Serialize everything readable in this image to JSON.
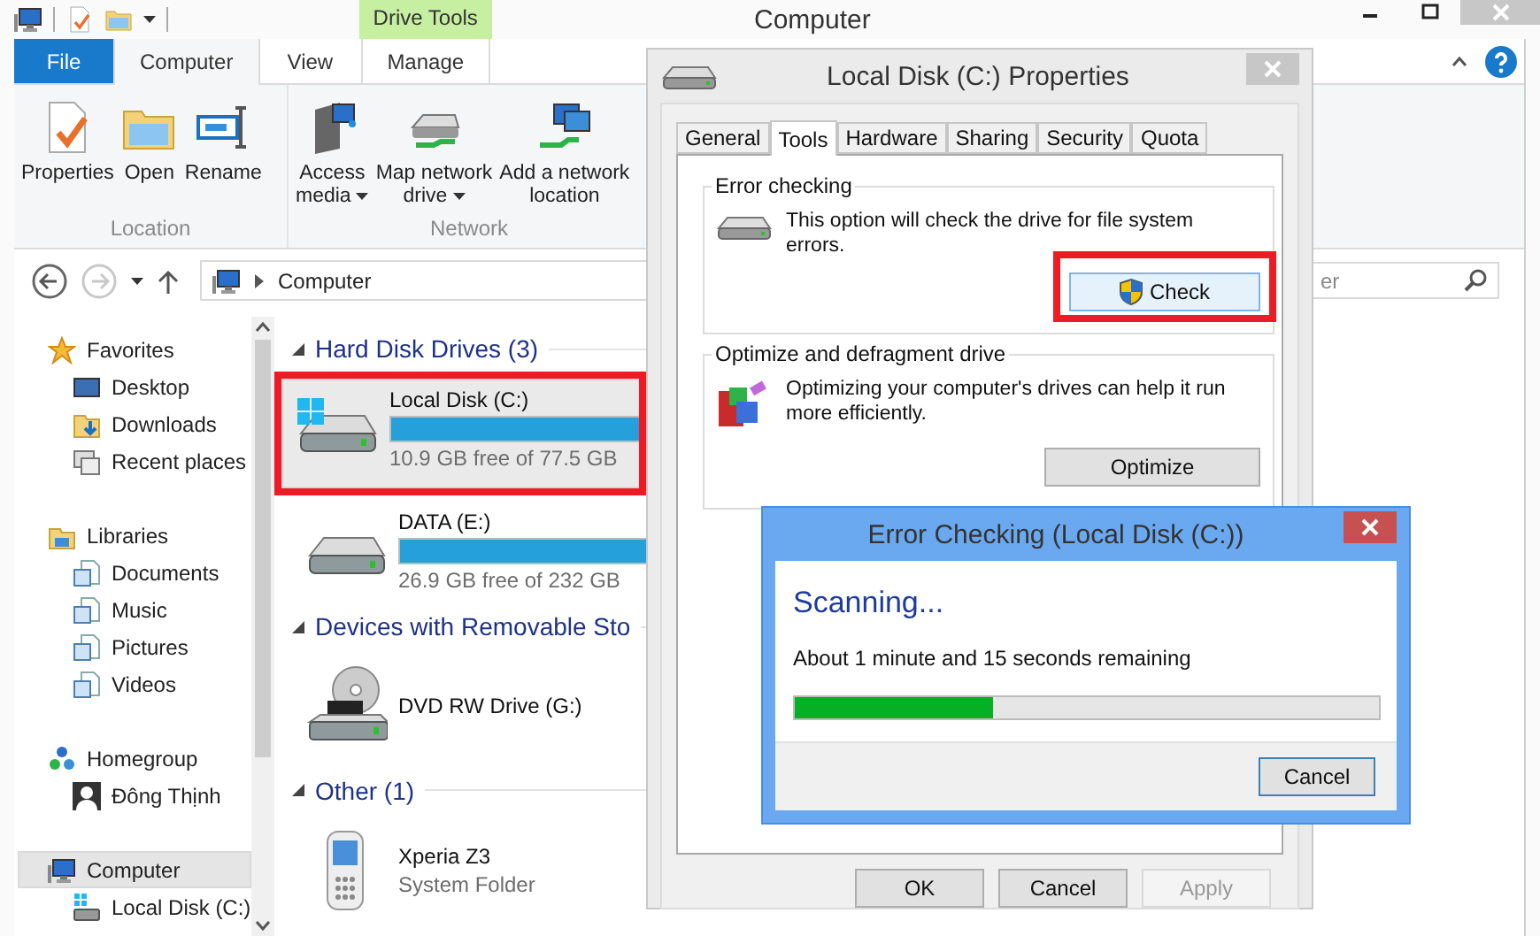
{
  "window": {
    "title": "Computer"
  },
  "ribbon": {
    "tabs": [
      {
        "label": "File",
        "kind": "file",
        "selected": false
      },
      {
        "label": "Computer",
        "kind": "tab",
        "selected": true
      },
      {
        "label": "View",
        "kind": "tab",
        "selected": false
      },
      {
        "label": "Manage",
        "kind": "tab",
        "selected": false,
        "context": "Drive Tools"
      }
    ],
    "groups": [
      {
        "label": "Location",
        "buttons": [
          {
            "lines": [
              "Properties"
            ],
            "dropdown": false
          },
          {
            "lines": [
              "Open"
            ],
            "dropdown": false
          },
          {
            "lines": [
              "Rename"
            ],
            "dropdown": false
          }
        ]
      },
      {
        "label": "Network",
        "buttons": [
          {
            "lines": [
              "Access",
              "media"
            ],
            "dropdown": true
          },
          {
            "lines": [
              "Map network",
              "drive"
            ],
            "dropdown": true
          },
          {
            "lines": [
              "Add a network",
              "location"
            ],
            "dropdown": false
          }
        ]
      }
    ]
  },
  "address": {
    "path": "Computer"
  },
  "search": {
    "placeholder": "er"
  },
  "navigation": [
    {
      "label": "Favorites",
      "selected": false,
      "children": [
        {
          "label": "Desktop",
          "selected": false
        },
        {
          "label": "Downloads",
          "selected": false
        },
        {
          "label": "Recent places",
          "selected": false
        }
      ]
    },
    {
      "label": "Libraries",
      "selected": false,
      "children": [
        {
          "label": "Documents",
          "selected": false
        },
        {
          "label": "Music",
          "selected": false
        },
        {
          "label": "Pictures",
          "selected": false
        },
        {
          "label": "Videos",
          "selected": false
        }
      ]
    },
    {
      "label": "Homegroup",
      "selected": false,
      "children": [
        {
          "label": "Đông Thịnh",
          "selected": false
        }
      ]
    },
    {
      "label": "Computer",
      "selected": true,
      "children": [
        {
          "label": "Local Disk (C:)",
          "selected": false
        }
      ]
    }
  ],
  "content": [
    {
      "title": "Hard Disk Drives (3)",
      "expanded": true,
      "items": [
        {
          "kind": "drive",
          "name": "Local Disk (C:)",
          "detail": "10.9 GB free of 77.5 GB",
          "system": true,
          "highlighted": true
        },
        {
          "kind": "drive",
          "name": "DATA (E:)",
          "detail": "26.9 GB free of 232 GB",
          "system": false,
          "highlighted": false
        }
      ]
    },
    {
      "title": "Devices with Removable Sto",
      "expanded": true,
      "items": [
        {
          "kind": "dvd",
          "name": "DVD RW Drive (G:)",
          "highlighted": false
        }
      ]
    },
    {
      "title": "Other (1)",
      "expanded": true,
      "items": [
        {
          "kind": "phone",
          "name": "Xperia Z3",
          "detail": "System Folder",
          "highlighted": false
        }
      ]
    }
  ],
  "properties_dialog": {
    "title": "Local Disk (C:) Properties",
    "tabs": [
      {
        "label": "General",
        "selected": false
      },
      {
        "label": "Tools",
        "selected": true
      },
      {
        "label": "Hardware",
        "selected": false
      },
      {
        "label": "Sharing",
        "selected": false
      },
      {
        "label": "Security",
        "selected": false
      },
      {
        "label": "Quota",
        "selected": false
      }
    ],
    "sections": [
      {
        "title": "Error checking",
        "text": "This option will check the drive for file system errors.",
        "button": "Check",
        "shield": true,
        "highlighted": true
      },
      {
        "title": "Optimize and defragment drive",
        "text": "Optimizing your computer's drives can help it run more efficiently.",
        "button": "Optimize",
        "shield": false,
        "highlighted": false
      }
    ],
    "buttons": [
      {
        "label": "OK",
        "disabled": false
      },
      {
        "label": "Cancel",
        "disabled": false
      },
      {
        "label": "Apply",
        "disabled": true
      }
    ]
  },
  "error_dialog": {
    "title": "Error Checking (Local Disk (C:))",
    "heading": "Scanning...",
    "message": "About 1 minute and 15 seconds remaining",
    "level": 0.34,
    "button": "Cancel"
  }
}
